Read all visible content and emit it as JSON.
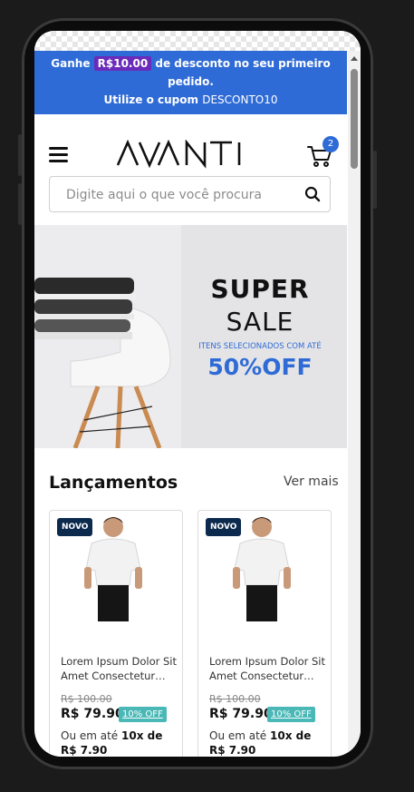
{
  "promo": {
    "prefix": "Ganhe",
    "amount": "R$10.00",
    "suffix": "de desconto no seu primeiro pedido.",
    "coupon_prefix": "Utilize o cupom",
    "coupon_code": "DESCONTO10"
  },
  "header": {
    "logo_text": "AVANTI",
    "cart_count": "2"
  },
  "search": {
    "placeholder": "Digite aqui o que você procura"
  },
  "banner": {
    "line1": "SUPER",
    "line2": "SALE",
    "line3": "ITENS SELECIONADOS COM ATÉ",
    "line4": "50%OFF"
  },
  "section": {
    "title": "Lançamentos",
    "see_more": "Ver mais"
  },
  "products": [
    {
      "badge": "NOVO",
      "name": "Lorem Ipsum Dolor Sit Amet Consectetur…",
      "old_price": "R$ 100.00",
      "price": "R$ 79.90",
      "discount": "10% OFF",
      "installment_prefix": "Ou em até",
      "installment_value": "10x de R$ 7.90"
    },
    {
      "badge": "NOVO",
      "name": "Lorem Ipsum Dolor Sit Amet Consectetur…",
      "old_price": "R$ 100.00",
      "price": "R$ 79.90",
      "discount": "10% OFF",
      "installment_prefix": "Ou em até",
      "installment_value": "10x de R$ 7.90"
    }
  ],
  "colors": {
    "brand_blue": "#2f6bd6",
    "promo_pill": "#6a2bbb",
    "badge_navy": "#0c2a4e",
    "discount_teal": "#49b8b6"
  }
}
